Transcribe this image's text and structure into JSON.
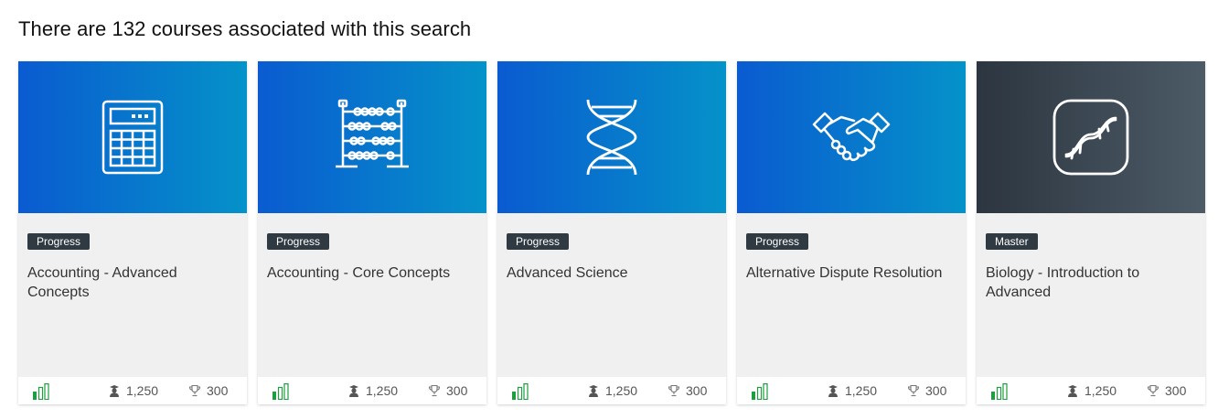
{
  "header": {
    "result_text": "There are 132 courses associated with this search"
  },
  "colors": {
    "accent_blue_start": "#0a5bd0",
    "accent_blue_end": "#0592c9",
    "dark_start": "#2c3540",
    "dark_end": "#4c5b66",
    "badge": "#2f3a43",
    "level_green": "#1e9e3e"
  },
  "courses": [
    {
      "badge": "Progress",
      "title": "Accounting - Advanced Concepts",
      "icon": "calculator-icon",
      "students": "1,250",
      "points": "300"
    },
    {
      "badge": "Progress",
      "title": "Accounting - Core Concepts",
      "icon": "abacus-icon",
      "students": "1,250",
      "points": "300"
    },
    {
      "badge": "Progress",
      "title": "Advanced Science",
      "icon": "dna-icon",
      "students": "1,250",
      "points": "300"
    },
    {
      "badge": "Progress",
      "title": "Alternative Dispute Resolution",
      "icon": "handshake-icon",
      "students": "1,250",
      "points": "300"
    },
    {
      "badge": "Master",
      "title": "Biology - Introduction to Advanced",
      "icon": "dna-badge-icon",
      "students": "1,250",
      "points": "300"
    }
  ]
}
